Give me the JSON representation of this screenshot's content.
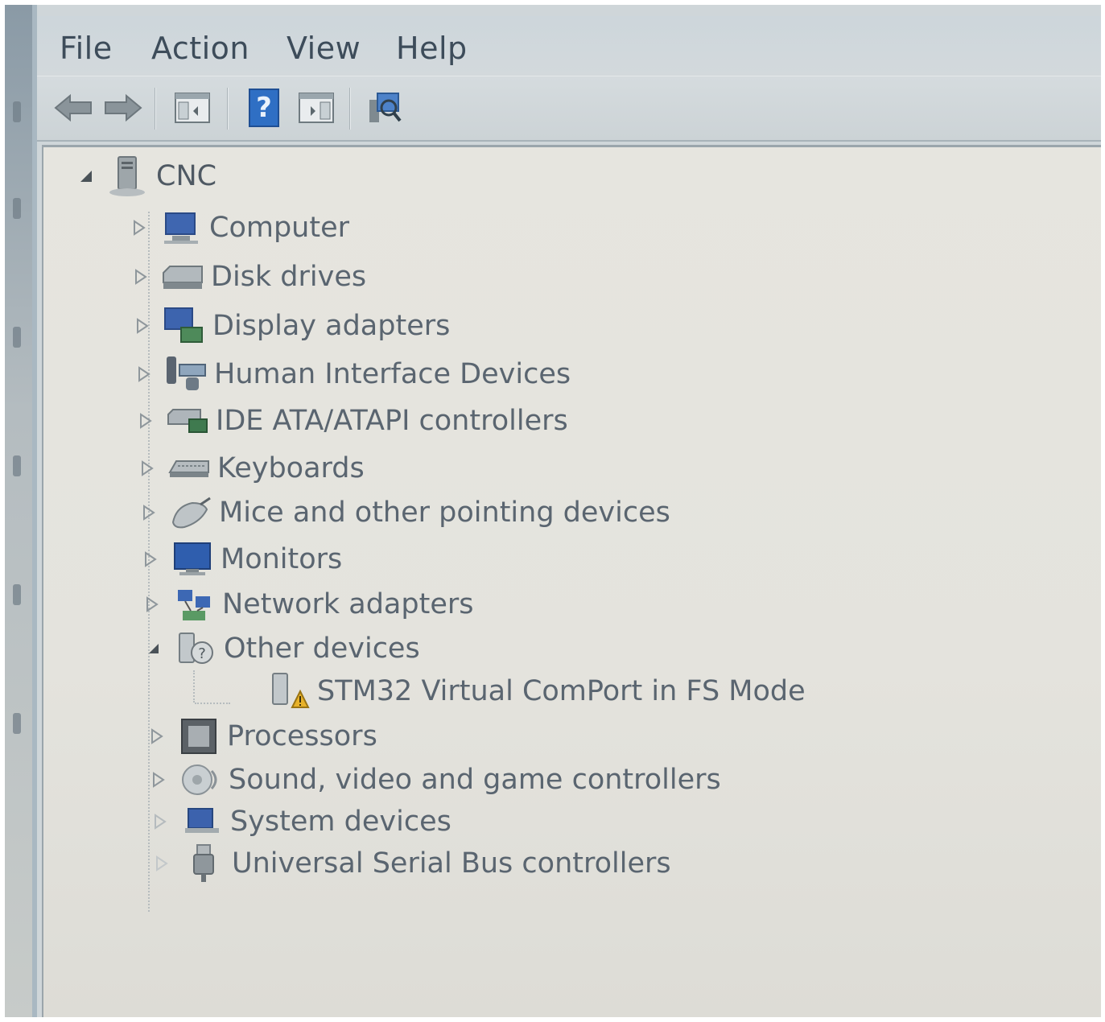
{
  "menubar": {
    "items": [
      {
        "label": "File"
      },
      {
        "label": "Action"
      },
      {
        "label": "View"
      },
      {
        "label": "Help"
      }
    ]
  },
  "toolbar": {
    "buttons": [
      {
        "icon": "back-arrow-icon"
      },
      {
        "icon": "forward-arrow-icon"
      },
      {
        "icon": "show-hide-console-tree-icon"
      },
      {
        "icon": "help-icon"
      },
      {
        "icon": "show-action-pane-icon"
      },
      {
        "icon": "scan-hardware-changes-icon"
      }
    ]
  },
  "tree": {
    "root": {
      "label": "CNC",
      "expanded": true,
      "icon": "computer-tower-icon"
    },
    "categories": [
      {
        "label": "Computer",
        "icon": "computer-icon",
        "expanded": false
      },
      {
        "label": "Disk drives",
        "icon": "disk-drive-icon",
        "expanded": false
      },
      {
        "label": "Display adapters",
        "icon": "display-adapter-icon",
        "expanded": false
      },
      {
        "label": "Human Interface Devices",
        "icon": "hid-icon",
        "expanded": false
      },
      {
        "label": "IDE ATA/ATAPI controllers",
        "icon": "ide-controller-icon",
        "expanded": false
      },
      {
        "label": "Keyboards",
        "icon": "keyboard-icon",
        "expanded": false
      },
      {
        "label": "Mice and other pointing devices",
        "icon": "mouse-icon",
        "expanded": false
      },
      {
        "label": "Monitors",
        "icon": "monitor-icon",
        "expanded": false
      },
      {
        "label": "Network adapters",
        "icon": "network-adapter-icon",
        "expanded": false
      },
      {
        "label": "Other devices",
        "icon": "unknown-device-icon",
        "expanded": true,
        "children": [
          {
            "label": "STM32 Virtual ComPort in FS Mode",
            "icon": "warning-device-icon"
          }
        ]
      },
      {
        "label": "Processors",
        "icon": "processor-icon",
        "expanded": false
      },
      {
        "label": "Sound, video and game controllers",
        "icon": "sound-icon",
        "expanded": false
      },
      {
        "label": "System devices",
        "icon": "system-device-icon",
        "expanded": false
      },
      {
        "label": "Universal Serial Bus controllers",
        "icon": "usb-icon",
        "expanded": false
      }
    ]
  },
  "colors": {
    "menu_text": "#3d4c5a",
    "tree_text": "#5a6570",
    "content_bg": "#e6e5df",
    "toolbar_bg": "#d5dbde",
    "help_blue": "#2f6fc4"
  }
}
